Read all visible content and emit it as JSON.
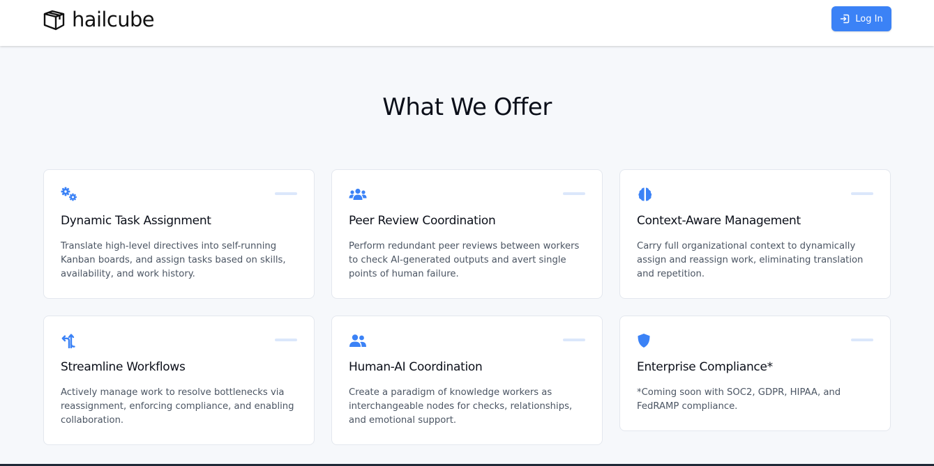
{
  "brand": {
    "name": "hailcube",
    "icon": "cube-icon"
  },
  "nav": {
    "login_label": "Log In",
    "login_icon": "login-icon"
  },
  "section": {
    "title": "What We Offer"
  },
  "accent_color": "#3b82f6",
  "cards": [
    {
      "icon": "gears-icon",
      "title": "Dynamic Task Assignment",
      "desc": "Translate high-level directives into self-running Kanban boards, and assign tasks based on skills, availability, and work history."
    },
    {
      "icon": "users-icon",
      "title": "Peer Review Coordination",
      "desc": "Perform redundant peer reviews between workers to check AI-generated outputs and avert single points of human failure."
    },
    {
      "icon": "brain-icon",
      "title": "Context-Aware Management",
      "desc": "Carry full organizational context to dynamically assign and reassign work, eliminating translation and repetition."
    },
    {
      "icon": "split-arrows-icon",
      "title": "Streamline Workflows",
      "desc": "Actively manage work to resolve bottlenecks via reassignment, enforcing compliance, and enabling collaboration."
    },
    {
      "icon": "user-group-icon",
      "title": "Human-AI Coordination",
      "desc": "Create a paradigm of knowledge workers as interchangeable nodes for checks, relationships, and emotional support."
    },
    {
      "icon": "shield-icon",
      "title": "Enterprise Compliance*",
      "desc": "*Coming soon with SOC2, GDPR, HIPAA, and FedRAMP compliance."
    }
  ]
}
